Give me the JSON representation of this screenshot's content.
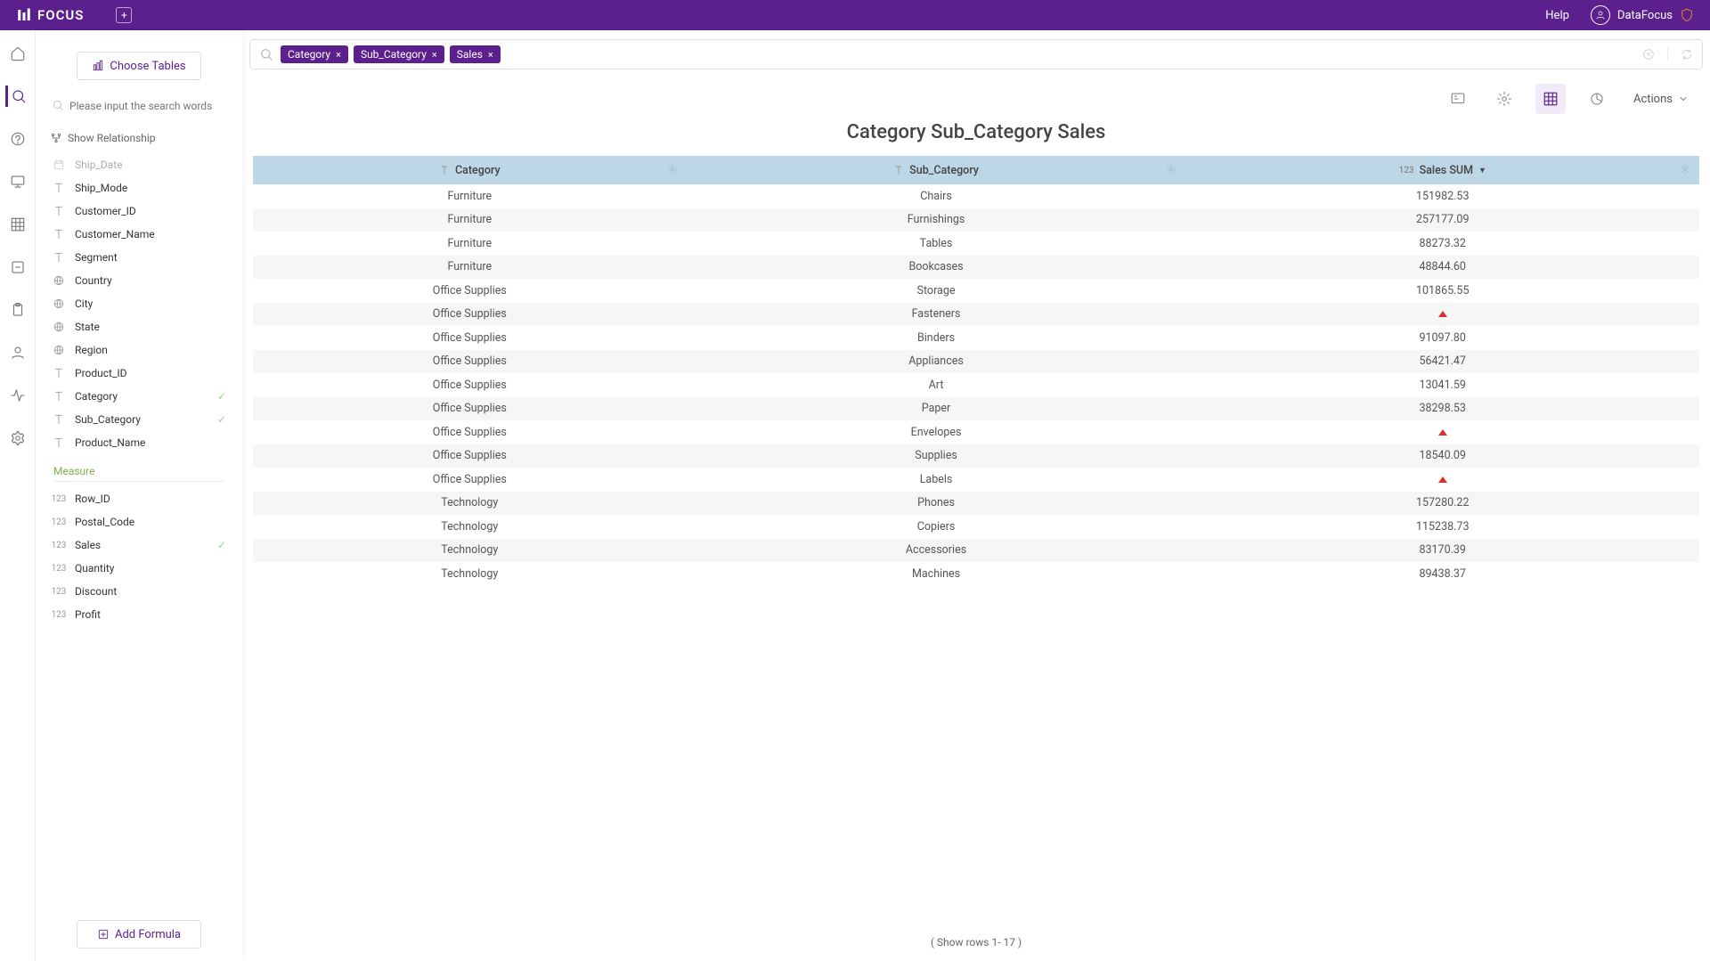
{
  "topbar": {
    "logo_text": "FOCUS",
    "help_label": "Help",
    "user_name": "DataFocus"
  },
  "sidepanel": {
    "choose_tables_label": "Choose Tables",
    "search_placeholder": "Please input the search words",
    "show_relationship_label": "Show Relationship",
    "measure_section_label": "Measure",
    "add_formula_label": "Add Formula",
    "attributes": [
      {
        "type": "date",
        "name": "Ship_Date",
        "selected": false,
        "dim": true
      },
      {
        "type": "text",
        "name": "Ship_Mode",
        "selected": false
      },
      {
        "type": "text",
        "name": "Customer_ID",
        "selected": false
      },
      {
        "type": "text",
        "name": "Customer_Name",
        "selected": false
      },
      {
        "type": "text",
        "name": "Segment",
        "selected": false
      },
      {
        "type": "geo",
        "name": "Country",
        "selected": false
      },
      {
        "type": "geo",
        "name": "City",
        "selected": false
      },
      {
        "type": "geo",
        "name": "State",
        "selected": false
      },
      {
        "type": "geo",
        "name": "Region",
        "selected": false
      },
      {
        "type": "text",
        "name": "Product_ID",
        "selected": false
      },
      {
        "type": "text",
        "name": "Category",
        "selected": true
      },
      {
        "type": "text",
        "name": "Sub_Category",
        "selected": true
      },
      {
        "type": "text",
        "name": "Product_Name",
        "selected": false
      }
    ],
    "measures": [
      {
        "type": "num",
        "name": "Row_ID",
        "selected": false
      },
      {
        "type": "num",
        "name": "Postal_Code",
        "selected": false
      },
      {
        "type": "num",
        "name": "Sales",
        "selected": true
      },
      {
        "type": "num",
        "name": "Quantity",
        "selected": false
      },
      {
        "type": "num",
        "name": "Discount",
        "selected": false
      },
      {
        "type": "num",
        "name": "Profit",
        "selected": false
      }
    ]
  },
  "searchbar": {
    "chips": [
      "Category",
      "Sub_Category",
      "Sales"
    ]
  },
  "toolbar": {
    "actions_label": "Actions"
  },
  "main": {
    "title": "Category Sub_Category Sales",
    "columns": [
      {
        "label": "Category",
        "type": "text",
        "sort": null
      },
      {
        "label": "Sub_Category",
        "type": "text",
        "sort": null
      },
      {
        "label": "Sales SUM",
        "type": "num",
        "sort": "desc"
      }
    ],
    "rows": [
      {
        "c0": "Furniture",
        "c1": "Chairs",
        "c2": "151982.53"
      },
      {
        "c0": "Furniture",
        "c1": "Furnishings",
        "c2": "257177.09"
      },
      {
        "c0": "Furniture",
        "c1": "Tables",
        "c2": "88273.32"
      },
      {
        "c0": "Furniture",
        "c1": "Bookcases",
        "c2": "48844.60"
      },
      {
        "c0": "Office Supplies",
        "c1": "Storage",
        "c2": "101865.55"
      },
      {
        "c0": "Office Supplies",
        "c1": "Fasteners",
        "c2": null
      },
      {
        "c0": "Office Supplies",
        "c1": "Binders",
        "c2": "91097.80"
      },
      {
        "c0": "Office Supplies",
        "c1": "Appliances",
        "c2": "56421.47"
      },
      {
        "c0": "Office Supplies",
        "c1": "Art",
        "c2": "13041.59"
      },
      {
        "c0": "Office Supplies",
        "c1": "Paper",
        "c2": "38298.53"
      },
      {
        "c0": "Office Supplies",
        "c1": "Envelopes",
        "c2": null
      },
      {
        "c0": "Office Supplies",
        "c1": "Supplies",
        "c2": "18540.09"
      },
      {
        "c0": "Office Supplies",
        "c1": "Labels",
        "c2": null
      },
      {
        "c0": "Technology",
        "c1": "Phones",
        "c2": "157280.22"
      },
      {
        "c0": "Technology",
        "c1": "Copiers",
        "c2": "115238.73"
      },
      {
        "c0": "Technology",
        "c1": "Accessories",
        "c2": "83170.39"
      },
      {
        "c0": "Technology",
        "c1": "Machines",
        "c2": "89438.37"
      }
    ],
    "footer_rows_text": "( Show rows 1- 17 )"
  }
}
